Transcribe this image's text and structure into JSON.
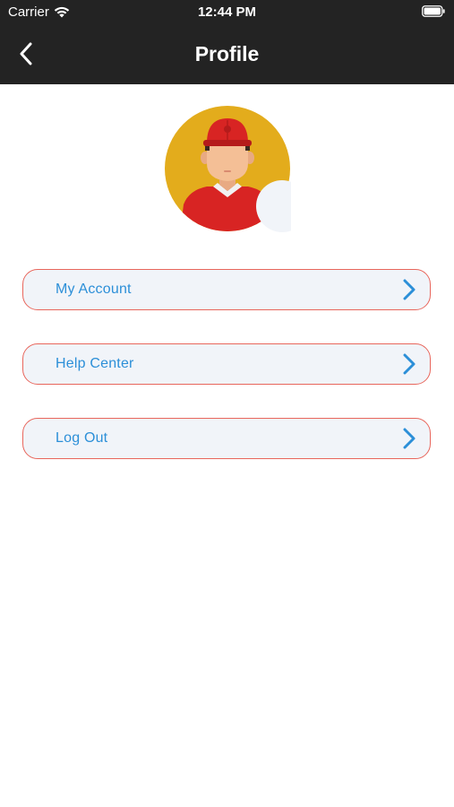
{
  "status_bar": {
    "carrier": "Carrier",
    "time": "12:44 PM",
    "wifi_icon": "wifi-icon",
    "battery_icon": "battery-icon"
  },
  "header": {
    "title": "Profile",
    "back_icon": "chevron-left-icon",
    "background": "#232323"
  },
  "profile": {
    "avatar_icon": "delivery-person-avatar",
    "avatar_bg": "#e3ac1c"
  },
  "menu": {
    "items": [
      {
        "label": "My Account",
        "icon": "chevron-right-icon"
      },
      {
        "label": "Help Center",
        "icon": "chevron-right-icon"
      },
      {
        "label": "Log Out",
        "icon": "chevron-right-icon"
      }
    ],
    "text_color": "#2c8fd8",
    "border_color": "#e8665c",
    "item_bg": "#f1f4f9"
  }
}
